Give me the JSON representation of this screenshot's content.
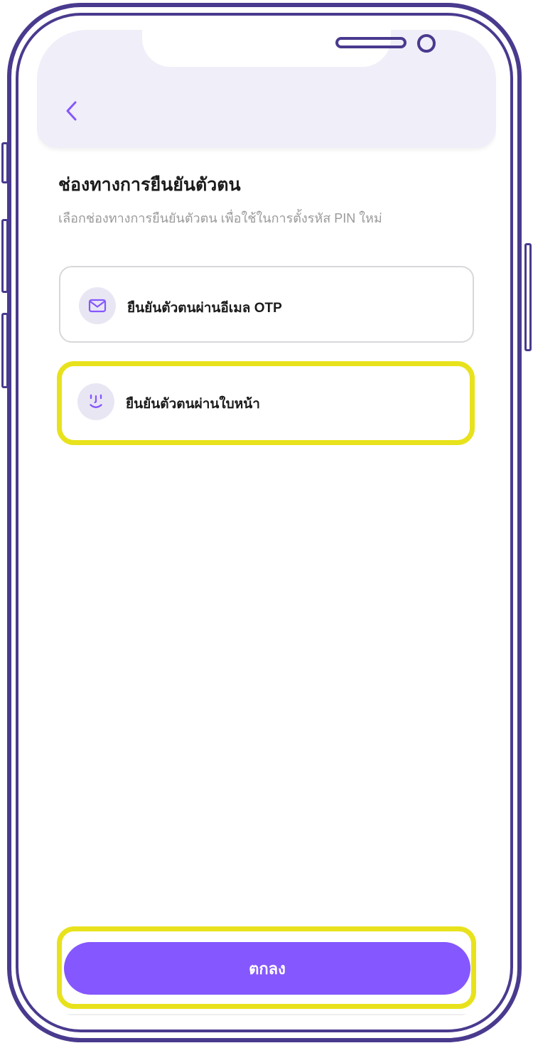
{
  "header": {
    "back_icon": "chevron-left-icon"
  },
  "page": {
    "title": "ช่องทางการยืนยันตัวตน",
    "subtitle": "เลือกช่องทางการยืนยันตัวตน เพื่อใช้ในการตั้งรหัส PIN ใหม่"
  },
  "options": [
    {
      "icon": "mail-icon",
      "label": "ยืนยันตัวตนผ่านอีเมล OTP",
      "highlighted": false
    },
    {
      "icon": "face-id-icon",
      "label": "ยืนยันตัวตนผ่านใบหน้า",
      "highlighted": true
    }
  ],
  "footer": {
    "confirm_label": "ตกลง",
    "confirm_highlighted": true
  },
  "colors": {
    "accent": "#8557fe",
    "icon_bg": "#e9e6f4",
    "header_bg": "#f0eef8",
    "frame": "#4a3a8e",
    "highlight": "#e8e21c"
  }
}
